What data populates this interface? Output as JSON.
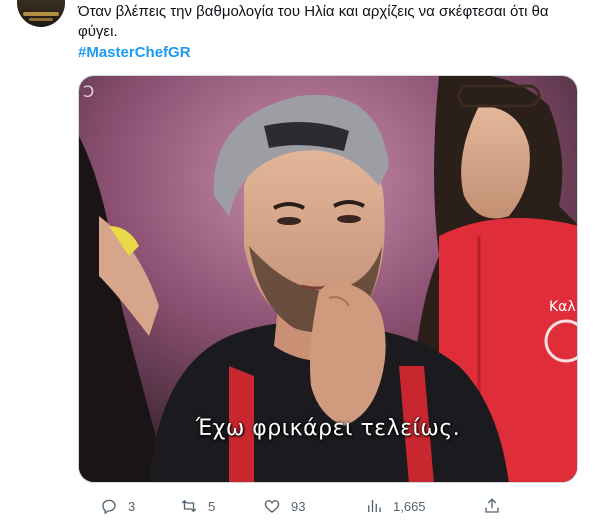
{
  "tweet": {
    "text_line1": "Όταν βλέπεις την βαθμολογία του Ηλία και αρχίζεις να σκέφτεσαι ότι θα",
    "text_line2": "φύγει.",
    "hashtag": "#MasterChefGR"
  },
  "media": {
    "subtitle": "Έχω φρικάρει τελείως.",
    "watermark": "Ↄ",
    "apron_text": "Καλ"
  },
  "actions": {
    "reply_count": "3",
    "retweet_count": "5",
    "like_count": "93",
    "views_count": "1,665"
  },
  "colors": {
    "accent": "#1d9bf0",
    "muted": "#536471"
  },
  "icons": [
    "reply-icon",
    "retweet-icon",
    "like-icon",
    "views-icon",
    "share-icon"
  ]
}
